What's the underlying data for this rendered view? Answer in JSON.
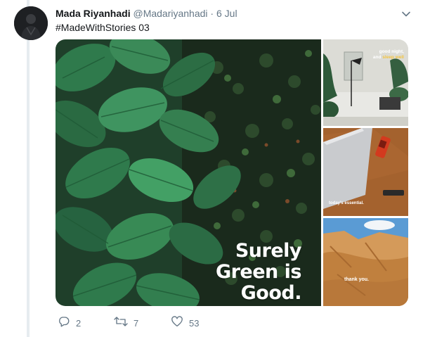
{
  "tweet": {
    "display_name": "Mada Riyanhadi",
    "handle": "@Madariyanhadi",
    "separator": "·",
    "time": "6 Jul",
    "text": "#MadeWithStories 03"
  },
  "media": {
    "main": {
      "line1": "Surely",
      "line2": "Green is",
      "line3": "Good."
    },
    "side1": {
      "line1": "good night,",
      "line2_a": "and ",
      "line2_b": "sleep well"
    },
    "side2": {
      "line1": "today's essential."
    },
    "side3": {
      "line1": "thank you."
    }
  },
  "actions": {
    "reply_count": "2",
    "retweet_count": "7",
    "like_count": "53"
  },
  "icons": {
    "reply": "reply-icon",
    "retweet": "retweet-icon",
    "like": "heart-icon",
    "caret": "chevron-down-icon"
  },
  "colors": {
    "secondary_text": "#657786",
    "thread_line": "#e6ecf0"
  }
}
